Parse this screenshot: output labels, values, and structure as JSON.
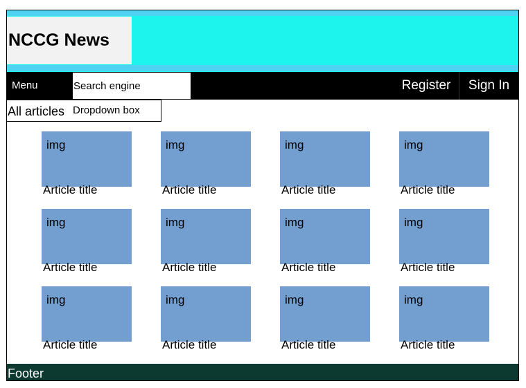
{
  "header": {
    "site_title": "NCCG News"
  },
  "navbar": {
    "menu_label": "Menu",
    "search_placeholder": "Search engine",
    "register_label": "Register",
    "signin_label": "Sign In"
  },
  "filter": {
    "label": "All articles",
    "dropdown_label": "Dropdown box"
  },
  "articles": [
    {
      "img": "img",
      "title": "Article title"
    },
    {
      "img": "img",
      "title": "Article title"
    },
    {
      "img": "img",
      "title": "Article title"
    },
    {
      "img": "img",
      "title": "Article title"
    },
    {
      "img": "img",
      "title": "Article title"
    },
    {
      "img": "img",
      "title": "Article title"
    },
    {
      "img": "img",
      "title": "Article title"
    },
    {
      "img": "img",
      "title": "Article title"
    },
    {
      "img": "img",
      "title": "Article title"
    },
    {
      "img": "img",
      "title": "Article title"
    },
    {
      "img": "img",
      "title": "Article title"
    },
    {
      "img": "img",
      "title": "Article title"
    }
  ],
  "footer": {
    "label": "Footer"
  },
  "colors": {
    "header_bg": "#1ef4ee",
    "header_stripe": "#4fd3f3",
    "nav_bg": "#000000",
    "card_img_bg": "#739fd0",
    "footer_bg": "#0d3a30"
  }
}
